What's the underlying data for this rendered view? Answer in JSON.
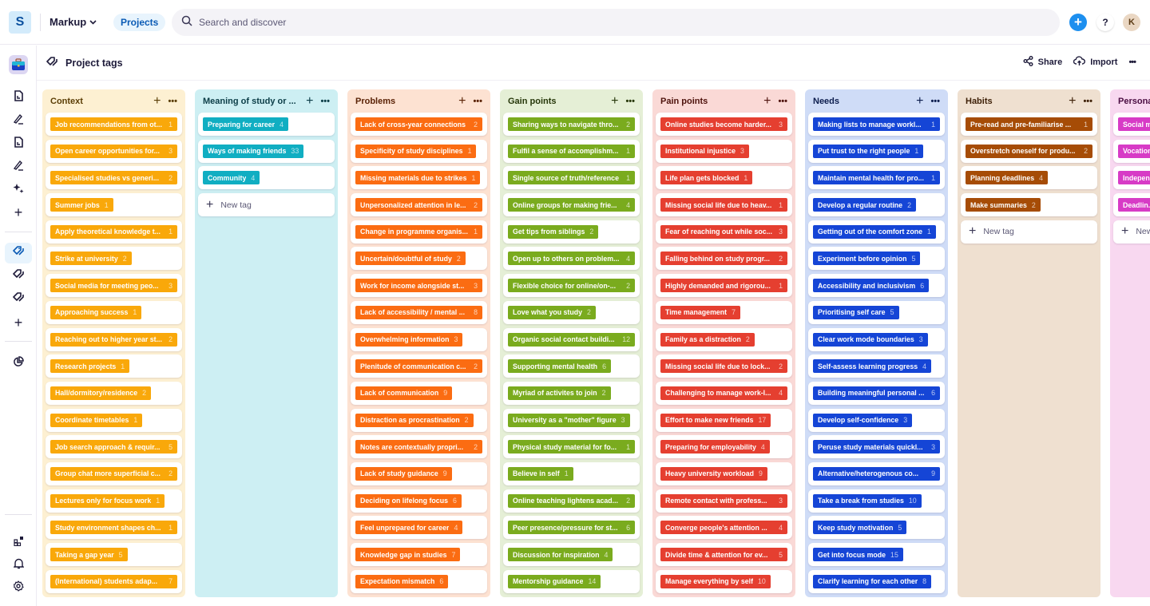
{
  "topbar": {
    "workspace_initial": "S",
    "workspace_name": "Markup",
    "projects_label": "Projects",
    "search_placeholder": "Search and discover",
    "help_label": "?",
    "avatar_initial": "K",
    "accent": "#1d8fef"
  },
  "page": {
    "title": "Project tags",
    "share_label": "Share",
    "import_label": "Import",
    "more_label": "•••"
  },
  "new_tag_label": "New tag",
  "columns": [
    {
      "title": "Context",
      "bg": "#fdf0d2",
      "tag_color": "#f9a80a",
      "title_color": "#5a3d05",
      "tags": [
        {
          "label": "Job recommendations from ot...",
          "count": "1",
          "full": true
        },
        {
          "label": "Open career opportunities for...",
          "count": "3",
          "full": true
        },
        {
          "label": "Specialised studies vs generi...",
          "count": "2",
          "full": true
        },
        {
          "label": "Summer jobs",
          "count": "1"
        },
        {
          "label": "Apply theoretical knowledge t...",
          "count": "1",
          "full": true
        },
        {
          "label": "Strike at university",
          "count": "2"
        },
        {
          "label": "Social media for meeting peo...",
          "count": "3",
          "full": true
        },
        {
          "label": "Approaching success",
          "count": "1"
        },
        {
          "label": "Reaching out to higher year st...",
          "count": "2",
          "full": true
        },
        {
          "label": "Research projects",
          "count": "1"
        },
        {
          "label": "Hall/dormitory/residence",
          "count": "2"
        },
        {
          "label": "Coordinate timetables",
          "count": "1"
        },
        {
          "label": "Job search approach & requir...",
          "count": "5",
          "full": true
        },
        {
          "label": "Group chat more superficial c...",
          "count": "2",
          "full": true
        },
        {
          "label": "Lectures only for focus work",
          "count": "1"
        },
        {
          "label": "Study environment shapes ch...",
          "count": "1",
          "full": true
        },
        {
          "label": "Taking a gap year",
          "count": "5"
        },
        {
          "label": "(International) students adap...",
          "count": "7",
          "full": true
        }
      ]
    },
    {
      "title": "Meaning of study or ...",
      "bg": "#cdeff3",
      "tag_color": "#10aec2",
      "title_color": "#0b3d47",
      "show_new": true,
      "tags": [
        {
          "label": "Preparing for career",
          "count": "4"
        },
        {
          "label": "Ways of making friends",
          "count": "33"
        },
        {
          "label": "Community",
          "count": "4"
        }
      ]
    },
    {
      "title": "Problems",
      "bg": "#fde2d2",
      "tag_color": "#fb6c12",
      "title_color": "#5a2206",
      "tags": [
        {
          "label": "Lack of cross-year connections",
          "count": "2",
          "full": true
        },
        {
          "label": "Specificity of study disciplines",
          "count": "1"
        },
        {
          "label": "Missing materials due to strikes",
          "count": "1"
        },
        {
          "label": "Unpersonalized attention in le...",
          "count": "2",
          "full": true
        },
        {
          "label": "Change in programme organis...",
          "count": "1",
          "full": true
        },
        {
          "label": "Uncertain/doubtful of study",
          "count": "2"
        },
        {
          "label": "Work for income alongside st...",
          "count": "3",
          "full": true
        },
        {
          "label": "Lack of accessibility / mental ...",
          "count": "8",
          "full": true
        },
        {
          "label": "Overwhelming information",
          "count": "3"
        },
        {
          "label": "Plenitude of communication c...",
          "count": "2",
          "full": true
        },
        {
          "label": "Lack of communication",
          "count": "9"
        },
        {
          "label": "Distraction as procrastination",
          "count": "2"
        },
        {
          "label": "Notes are contextually propri...",
          "count": "2",
          "full": true
        },
        {
          "label": "Lack of study guidance",
          "count": "9"
        },
        {
          "label": "Deciding on lifelong focus",
          "count": "6"
        },
        {
          "label": "Feel unprepared for career",
          "count": "4"
        },
        {
          "label": "Knowledge gap in studies",
          "count": "7"
        },
        {
          "label": "Expectation mismatch",
          "count": "6"
        }
      ]
    },
    {
      "title": "Gain points",
      "bg": "#e5efd6",
      "tag_color": "#7aab1e",
      "title_color": "#26370a",
      "tags": [
        {
          "label": "Sharing ways to navigate thro...",
          "count": "2",
          "full": true
        },
        {
          "label": "Fulfil a sense of accomplishm...",
          "count": "1",
          "full": true
        },
        {
          "label": "Single source of truth/reference",
          "count": "1",
          "full": true
        },
        {
          "label": "Online groups for making frie...",
          "count": "4",
          "full": true
        },
        {
          "label": "Get tips from siblings",
          "count": "2"
        },
        {
          "label": "Open up to others on problem...",
          "count": "4",
          "full": true
        },
        {
          "label": "Flexible choice for online/on-...",
          "count": "2",
          "full": true
        },
        {
          "label": "Love what you study",
          "count": "2"
        },
        {
          "label": "Organic social contact buildi...",
          "count": "12",
          "full": true
        },
        {
          "label": "Supporting mental health",
          "count": "6"
        },
        {
          "label": "Myriad of activites to join",
          "count": "2"
        },
        {
          "label": "University as a \"mother\" figure",
          "count": "3"
        },
        {
          "label": "Physical study material for fo...",
          "count": "1",
          "full": true
        },
        {
          "label": "Believe in self",
          "count": "1"
        },
        {
          "label": "Online teaching lightens acad...",
          "count": "2",
          "full": true
        },
        {
          "label": "Peer presence/pressure for st...",
          "count": "6",
          "full": true
        },
        {
          "label": "Discussion for inspiration",
          "count": "4"
        },
        {
          "label": "Mentorship guidance",
          "count": "14"
        }
      ]
    },
    {
      "title": "Pain points",
      "bg": "#fad9d6",
      "tag_color": "#e53f30",
      "title_color": "#4e120c",
      "tags": [
        {
          "label": "Online studies become harder...",
          "count": "3",
          "full": true
        },
        {
          "label": "Institutional injustice",
          "count": "3"
        },
        {
          "label": "Life plan gets blocked",
          "count": "1"
        },
        {
          "label": "Missing social life due to heav...",
          "count": "1",
          "full": true
        },
        {
          "label": "Fear of reaching out while soc...",
          "count": "3",
          "full": true
        },
        {
          "label": "Falling behind on study progr...",
          "count": "2",
          "full": true
        },
        {
          "label": "Highly demanded and rigorou...",
          "count": "1",
          "full": true
        },
        {
          "label": "Time management",
          "count": "7"
        },
        {
          "label": "Family as a distraction",
          "count": "2"
        },
        {
          "label": "Missing social life due to lock...",
          "count": "2",
          "full": true
        },
        {
          "label": "Challenging to manage work-l...",
          "count": "4",
          "full": true
        },
        {
          "label": "Effort to make new friends",
          "count": "17"
        },
        {
          "label": "Preparing for employability",
          "count": "4"
        },
        {
          "label": "Heavy university workload",
          "count": "9"
        },
        {
          "label": "Remote contact with profess...",
          "count": "3",
          "full": true
        },
        {
          "label": "Converge people's attention ...",
          "count": "4",
          "full": true
        },
        {
          "label": "Divide time & attention for ev...",
          "count": "5",
          "full": true
        },
        {
          "label": "Manage everything by self",
          "count": "10"
        }
      ]
    },
    {
      "title": "Needs",
      "bg": "#cfdcf7",
      "tag_color": "#1545d6",
      "title_color": "#0c1d4e",
      "tags": [
        {
          "label": "Making lists to manage workl...",
          "count": "1",
          "full": true
        },
        {
          "label": "Put trust to the right people",
          "count": "1"
        },
        {
          "label": "Maintain mental health for pro...",
          "count": "1",
          "full": true
        },
        {
          "label": "Develop a regular routine",
          "count": "2"
        },
        {
          "label": "Getting out of the comfort zone",
          "count": "1"
        },
        {
          "label": "Experiment before opinion",
          "count": "5"
        },
        {
          "label": "Accessibility and inclusivism",
          "count": "6"
        },
        {
          "label": "Prioritising self care",
          "count": "5"
        },
        {
          "label": "Clear work mode boundaries",
          "count": "3"
        },
        {
          "label": "Self-assess learning progress",
          "count": "4"
        },
        {
          "label": "Building meaningful personal ...",
          "count": "6",
          "full": true
        },
        {
          "label": "Develop self-confidence",
          "count": "3"
        },
        {
          "label": "Peruse study materials quickl...",
          "count": "3",
          "full": true
        },
        {
          "label": "Alternative/heterogenous co...",
          "count": "9",
          "full": true
        },
        {
          "label": "Take a break from studies",
          "count": "10"
        },
        {
          "label": "Keep study motivation",
          "count": "5"
        },
        {
          "label": "Get into focus mode",
          "count": "15"
        },
        {
          "label": "Clarify learning for each other",
          "count": "8"
        }
      ]
    },
    {
      "title": "Habits",
      "bg": "#efe0d0",
      "tag_color": "#a64c06",
      "title_color": "#3d1f06",
      "show_new": true,
      "tags": [
        {
          "label": "Pre-read and pre-familiarise ...",
          "count": "1",
          "full": true
        },
        {
          "label": "Overstretch oneself for produ...",
          "count": "2",
          "full": true
        },
        {
          "label": "Planning deadlines",
          "count": "4"
        },
        {
          "label": "Make summaries",
          "count": "2"
        }
      ]
    },
    {
      "title": "Personal",
      "bg": "#f8d8f0",
      "tag_color": "#d73bc6",
      "title_color": "#4a0d42",
      "show_new": true,
      "tags": [
        {
          "label": "Social m...",
          "count": ""
        },
        {
          "label": "Vocation...",
          "count": ""
        },
        {
          "label": "Indepen...",
          "count": ""
        },
        {
          "label": "Deadlin...",
          "count": ""
        }
      ]
    }
  ]
}
